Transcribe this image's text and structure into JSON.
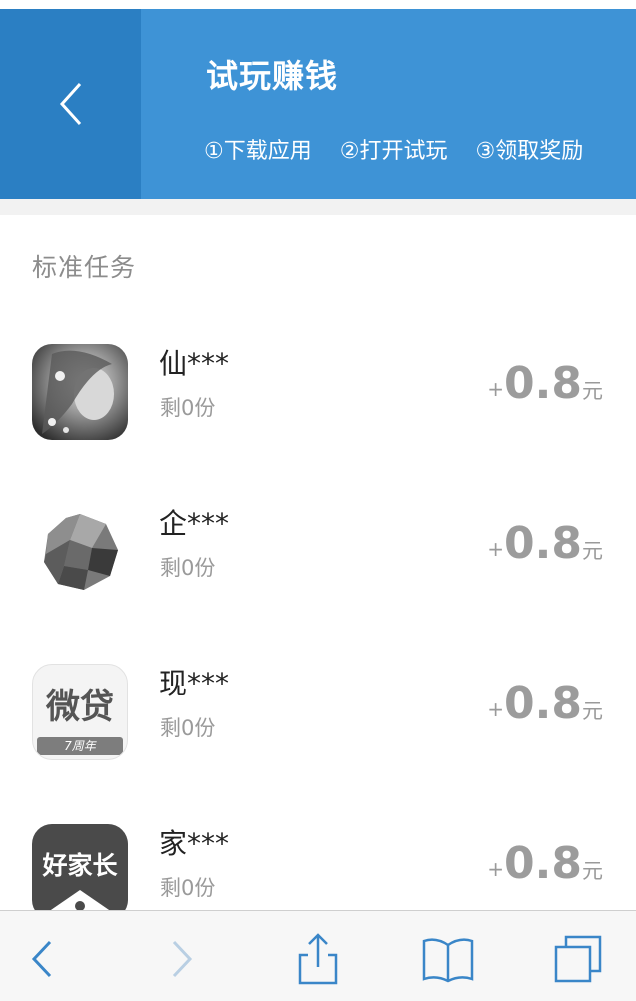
{
  "header": {
    "title": "试玩赚钱",
    "steps": [
      "①下载应用",
      "②打开试玩",
      "③领取奖励"
    ]
  },
  "section": {
    "title": "标准任务"
  },
  "tasks": [
    {
      "name": "仙***",
      "remaining": "剩0份",
      "plus": "+",
      "amount": "0.8",
      "unit": "元",
      "icon": "fantasy-game-icon"
    },
    {
      "name": "企***",
      "remaining": "剩0份",
      "plus": "+",
      "amount": "0.8",
      "unit": "元",
      "icon": "polygon-sphere-icon"
    },
    {
      "name": "现***",
      "remaining": "剩0份",
      "plus": "+",
      "amount": "0.8",
      "unit": "元",
      "icon": "weidai-app-icon",
      "icon_text": "微贷",
      "icon_sub": "7周年"
    },
    {
      "name": "家***",
      "remaining": "剩0份",
      "plus": "+",
      "amount": "0.8",
      "unit": "元",
      "icon": "haojiazhang-app-icon",
      "icon_text": "好家长"
    }
  ],
  "colors": {
    "header_bg": "#3e93d6",
    "back_panel_bg": "#2b7fc3",
    "accent_icon": "#3a86c8"
  },
  "bottom_bar": {
    "icons": [
      "back-icon",
      "forward-icon",
      "share-icon",
      "bookmarks-icon",
      "tabs-icon"
    ]
  }
}
